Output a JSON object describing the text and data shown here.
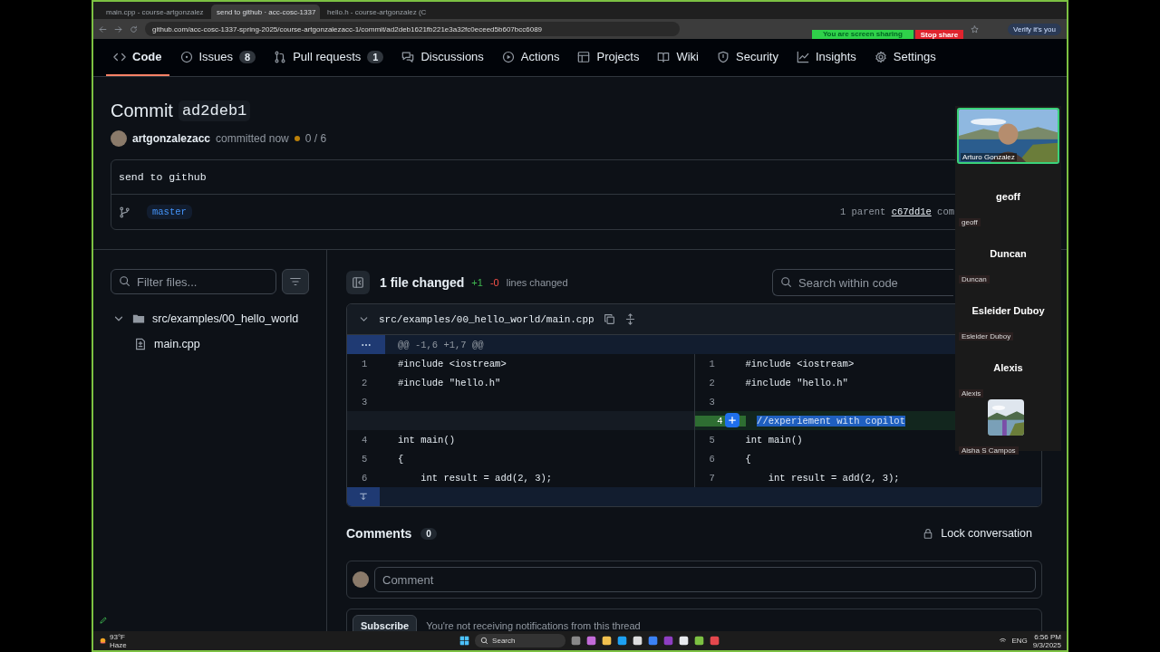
{
  "browser": {
    "tabs": [
      {
        "title": "main.cpp - course-artgonzalez",
        "selected": false
      },
      {
        "title": "send to github · acc-cosc-1337",
        "selected": true
      },
      {
        "title": "hello.h - course-artgonzalez (C",
        "selected": false
      }
    ],
    "url": "github.com/acc-cosc-1337-spring-2025/course-artgonzalezacc-1/commit/ad2deb1621fb221e3a32fc0eceed5b607bcc6089",
    "share_status": "You are screen sharing",
    "stop_share": "Stop share",
    "profile": "Verify it's you"
  },
  "repo_nav": [
    {
      "label": "Code",
      "selected": true
    },
    {
      "label": "Issues",
      "count": "8",
      "selected": false
    },
    {
      "label": "Pull requests",
      "count": "1",
      "selected": false
    },
    {
      "label": "Discussions",
      "selected": false
    },
    {
      "label": "Actions",
      "selected": false
    },
    {
      "label": "Projects",
      "selected": false
    },
    {
      "label": "Wiki",
      "selected": false
    },
    {
      "label": "Security",
      "selected": false
    },
    {
      "label": "Insights",
      "selected": false
    },
    {
      "label": "Settings",
      "selected": false
    }
  ],
  "commit": {
    "title": "Commit",
    "sha": "ad2deb1",
    "author": "artgonzalezacc",
    "time": "committed now",
    "checks": "0 / 6",
    "message": "send to github",
    "branch": "master",
    "parent_label": "1 parent",
    "parent_sha": "c67dd1e",
    "parent_trail": "com"
  },
  "files": {
    "filter_placeholder": "Filter files...",
    "tree": [
      {
        "name": "src/examples/00_hello_world",
        "kind": "folder",
        "expanded": true,
        "children": [
          {
            "name": "main.cpp",
            "kind": "file"
          }
        ]
      }
    ]
  },
  "diff": {
    "summary": "1 file changed",
    "additions": "+1",
    "deletions": "-0",
    "lines_label": "lines changed",
    "search_placeholder": "Search within code",
    "path": "src/examples/00_hello_world/main.cpp",
    "hunk": "@@ -1,6 +1,7 @@",
    "rows": [
      {
        "kind": "context",
        "left_num": "1",
        "left": "#include <iostream>",
        "right_num": "1",
        "right": "#include <iostream>"
      },
      {
        "kind": "context",
        "left_num": "2",
        "left": "#include \"hello.h\"",
        "right_num": "2",
        "right": "#include \"hello.h\""
      },
      {
        "kind": "context",
        "left_num": "3",
        "left": "",
        "right_num": "3",
        "right": ""
      },
      {
        "kind": "added",
        "right_num": "4",
        "right": "//experiement with copilot"
      },
      {
        "kind": "context",
        "left_num": "4",
        "left": "int main()",
        "right_num": "5",
        "right": "int main()"
      },
      {
        "kind": "context",
        "left_num": "5",
        "left": "{",
        "right_num": "6",
        "right": "{"
      },
      {
        "kind": "context",
        "left_num": "6",
        "left": "    int result = add(2, 3);",
        "right_num": "7",
        "right": "    int result = add(2, 3);"
      }
    ]
  },
  "comments": {
    "title": "Comments",
    "count": "0",
    "lock": "Lock conversation",
    "placeholder": "Comment",
    "subscribe": "Subscribe",
    "note": "You're not receiving notifications from this thread"
  },
  "meeting": {
    "participants": [
      {
        "kind": "video",
        "name": "Arturo Gonzalez"
      },
      {
        "kind": "name",
        "name": "geoff",
        "tag": "geoff"
      },
      {
        "kind": "name",
        "name": "Duncan",
        "tag": "Duncan"
      },
      {
        "kind": "name",
        "name": "Esleider Duboy",
        "tag": "Esleider Duboy"
      },
      {
        "kind": "name",
        "name": "Alexis",
        "tag": "Alexis"
      },
      {
        "tag": "Aisha S Campos"
      }
    ]
  },
  "taskbar": {
    "temp": "93°F",
    "weather": "Haze",
    "search": "Search",
    "lang": "ENG",
    "time": "6:56 PM",
    "date": "9/3/2025"
  }
}
